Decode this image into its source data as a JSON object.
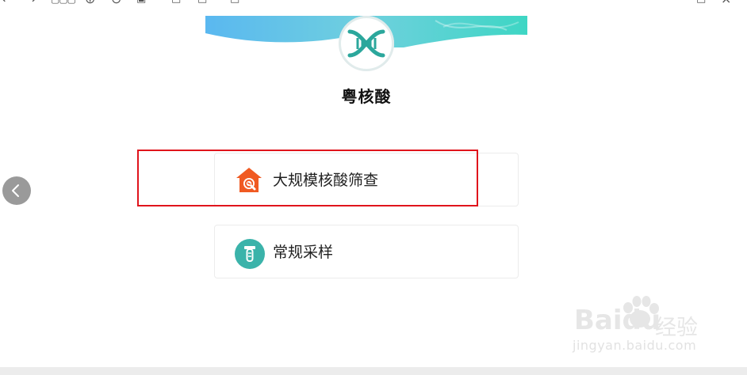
{
  "app": {
    "title": "粤核酸"
  },
  "menu": {
    "items": [
      {
        "label": "大规模核酸筛查",
        "icon": "house-search-icon"
      },
      {
        "label": "常规采样",
        "icon": "sample-tube-icon"
      }
    ]
  },
  "colors": {
    "accent_teal": "#3bb3aa",
    "accent_orange": "#f05a22",
    "highlight_red": "#e0141c"
  },
  "watermark": {
    "brand": "Bai",
    "brand2": "du",
    "cn": "经验",
    "url": "jingyan.baidu.com"
  }
}
